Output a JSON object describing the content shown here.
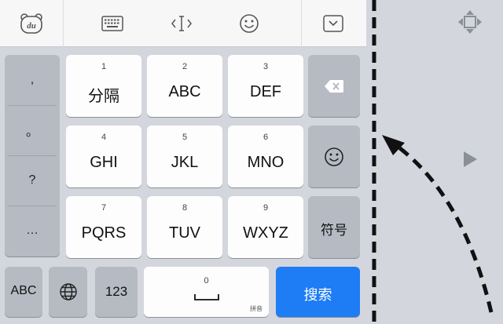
{
  "toolbar": {
    "logo_text": "du",
    "icons": [
      "bear-logo-icon",
      "keyboard-icon",
      "cursor-icon",
      "smiley-icon",
      "collapse-icon"
    ]
  },
  "side_punctuation": [
    ",",
    "。",
    "?",
    "…"
  ],
  "keys": {
    "row1": [
      {
        "num": "1",
        "label": "分隔"
      },
      {
        "num": "2",
        "label": "ABC"
      },
      {
        "num": "3",
        "label": "DEF"
      }
    ],
    "row2": [
      {
        "num": "4",
        "label": "GHI"
      },
      {
        "num": "5",
        "label": "JKL"
      },
      {
        "num": "6",
        "label": "MNO"
      }
    ],
    "row3": [
      {
        "num": "7",
        "label": "PQRS"
      },
      {
        "num": "8",
        "label": "TUV"
      },
      {
        "num": "9",
        "label": "WXYZ"
      }
    ]
  },
  "right_col": {
    "symbols_label": "符号"
  },
  "bottom": {
    "abc_label": "ABC",
    "num_label": "123",
    "space_num": "0",
    "space_hint": "拼音",
    "search_label": "搜索"
  },
  "colors": {
    "key_light": "#fdfdfd",
    "key_dark": "#b5bac3",
    "accent_blue": "#1e7cf5",
    "background": "#d3d6dc"
  }
}
